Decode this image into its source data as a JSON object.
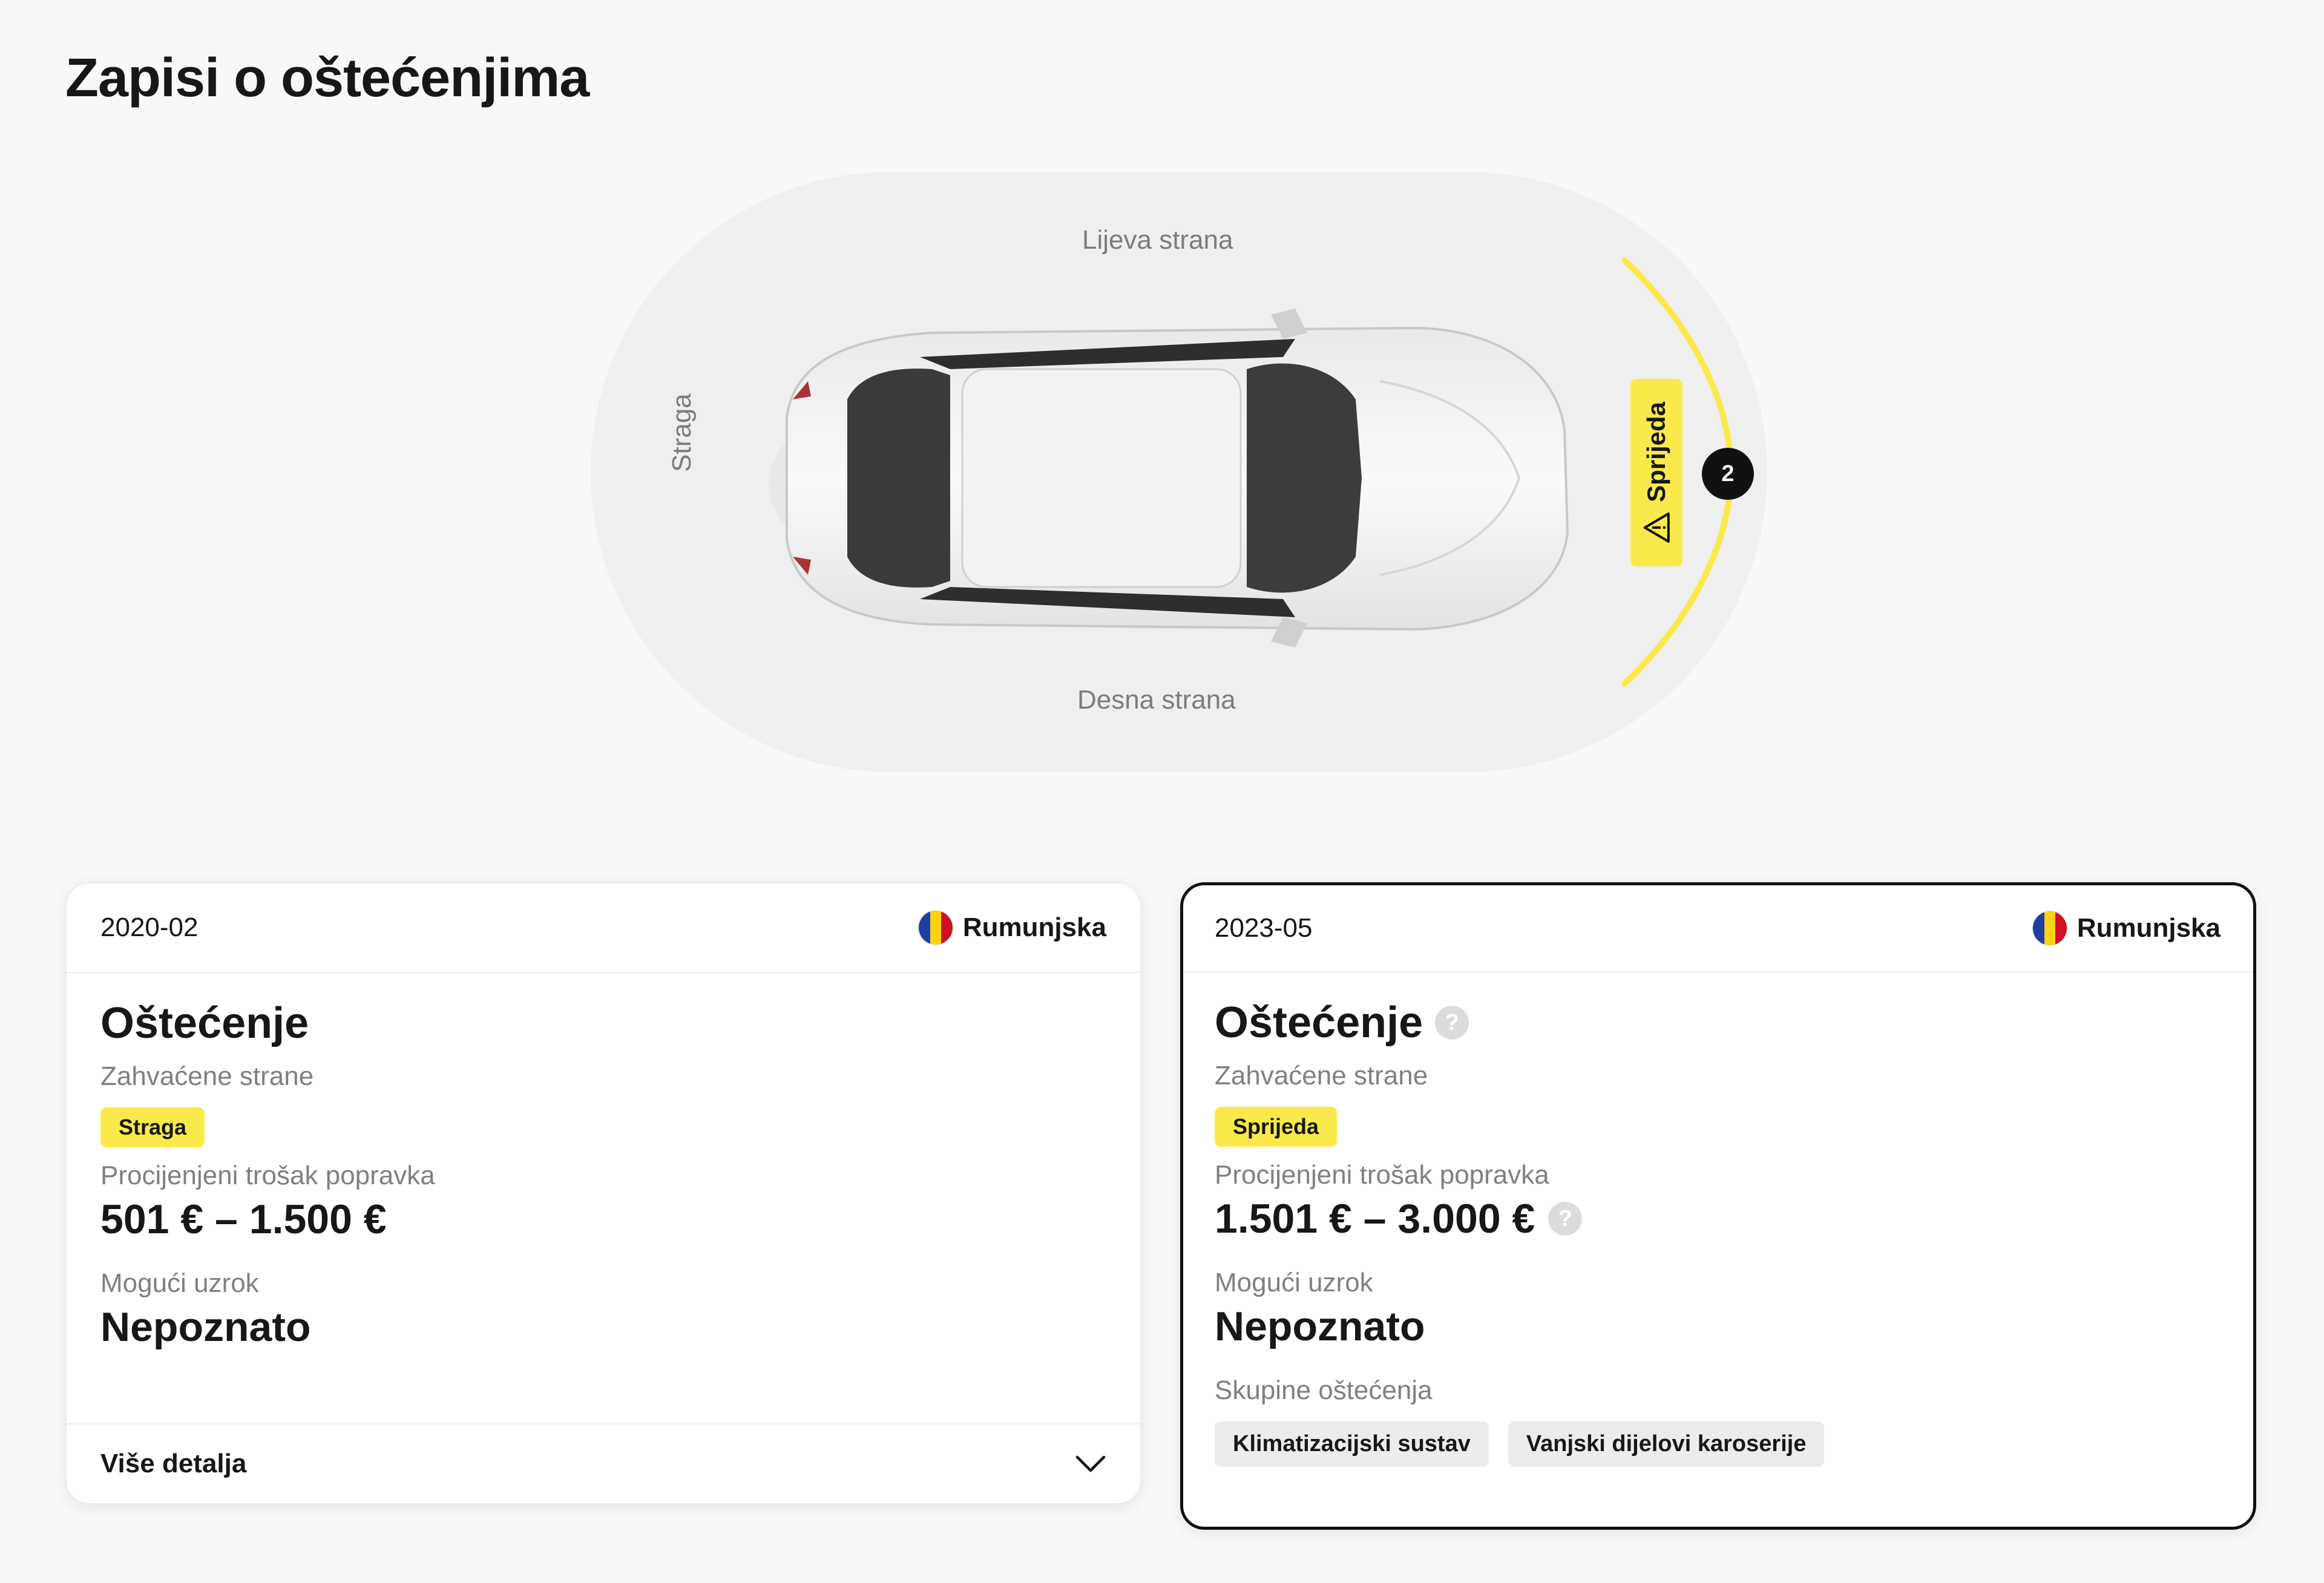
{
  "page": {
    "title": "Zapisi o oštećenjima"
  },
  "diagram": {
    "left_side": "Lijeva strana",
    "right_side": "Desna strana",
    "rear": "Straga",
    "front": "Sprijeda",
    "front_count": "2",
    "highlight_color": "#fbe94b"
  },
  "records": [
    {
      "date": "2020-02",
      "country": "Rumunjska",
      "title": "Oštećenje",
      "affected_label": "Zahvaćene strane",
      "affected_side": "Straga",
      "cost_label": "Procijenjeni trošak popravka",
      "cost": "501 € – 1.500 €",
      "cause_label": "Mogući uzrok",
      "cause": "Nepoznato",
      "more_details": "Više detalja"
    },
    {
      "date": "2023-05",
      "country": "Rumunjska",
      "title": "Oštećenje",
      "affected_label": "Zahvaćene strane",
      "affected_side": "Sprijeda",
      "cost_label": "Procijenjeni trošak popravka",
      "cost": "1.501 € – 3.000 €",
      "cause_label": "Mogući uzrok",
      "cause": "Nepoznato",
      "groups_label": "Skupine oštećenja",
      "groups": [
        "Klimatizacijski sustav",
        "Vanjski dijelovi karoserije"
      ]
    }
  ],
  "flag_colors": [
    "#1d3fa0",
    "#fcd116",
    "#ce1126"
  ]
}
